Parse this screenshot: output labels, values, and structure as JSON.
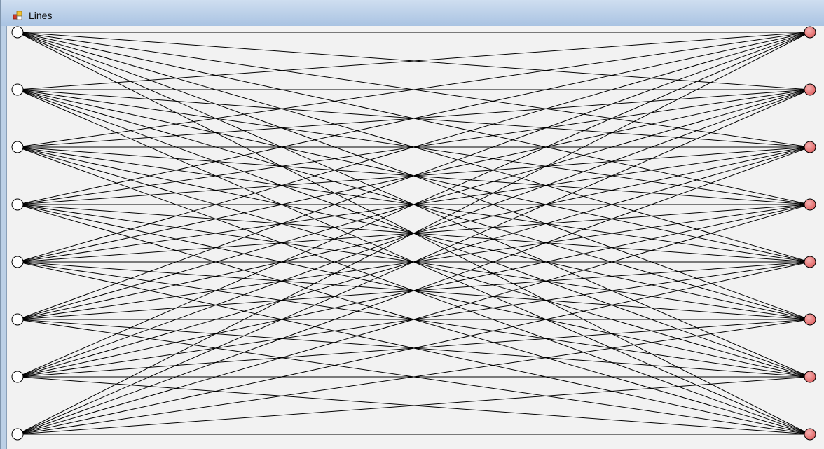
{
  "window": {
    "title": "Lines",
    "icon": "form-app-icon"
  },
  "graph": {
    "left_node_count": 8,
    "right_node_count": 8,
    "edges": "complete-bipartite",
    "colors": {
      "left_node_fill": "#ffffff",
      "right_node_fill": "#e06060",
      "right_node_highlight": "#f4b0b0",
      "node_stroke": "#000000",
      "edge_stroke": "#000000",
      "background": "#f2f2f2"
    }
  }
}
